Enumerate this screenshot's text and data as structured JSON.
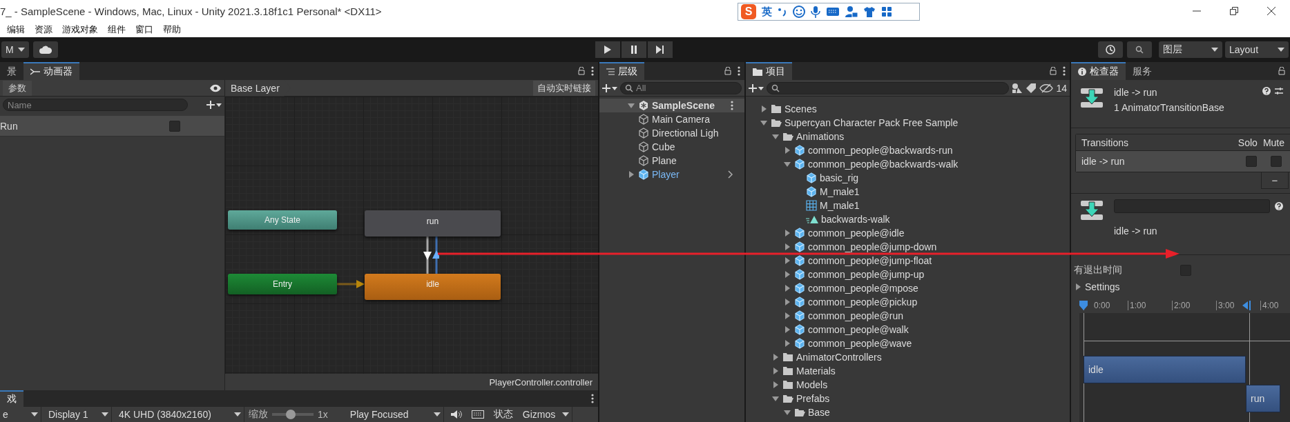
{
  "window": {
    "title": "7_ - SampleScene - Windows, Mac, Linux - Unity 2021.3.18f1c1 Personal* <DX11>"
  },
  "ime_bar": {
    "logo": "S",
    "mode": "英"
  },
  "menu": [
    "编辑",
    "资源",
    "游戏对象",
    "组件",
    "窗口",
    "帮助"
  ],
  "toolbar": {
    "account": "M",
    "layers": "图层",
    "layout": "Layout"
  },
  "animator": {
    "tabs": [
      {
        "label": "景",
        "selected": false
      },
      {
        "label": "动画器",
        "selected": true
      }
    ],
    "params_tab": "参数",
    "search_placeholder": "Name",
    "parameters": [
      {
        "name": "Run",
        "checked": false
      }
    ],
    "layer": "Base Layer",
    "live_link": "自动实时链接",
    "nodes": [
      {
        "label": "Any State",
        "kind": "any"
      },
      {
        "label": "run",
        "kind": "state"
      },
      {
        "label": "Entry",
        "kind": "entry"
      },
      {
        "label": "idle",
        "kind": "default"
      }
    ],
    "footer": "PlayerController.controller"
  },
  "game": {
    "tab": "戏",
    "display_mode": "e",
    "display": "Display 1",
    "resolution": "4K UHD (3840x2160)",
    "scale_label": "缩放",
    "scale_slider": {
      "level": 0.45
    },
    "scale": "1x",
    "play_mode": "Play Focused",
    "stats": "状态",
    "gizmos": "Gizmos"
  },
  "hierarchy": {
    "tab": "层级",
    "search_placeholder": "All",
    "scene": "SampleScene",
    "items": [
      {
        "label": "Main Camera",
        "kind": "object"
      },
      {
        "label": "Directional Ligh",
        "kind": "object"
      },
      {
        "label": "Cube",
        "kind": "object"
      },
      {
        "label": "Plane",
        "kind": "object"
      },
      {
        "label": "Player",
        "kind": "prefab"
      }
    ]
  },
  "project": {
    "tab": "项目",
    "hidden_count": "14",
    "tree": [
      {
        "label": "Scenes",
        "kind": "folder",
        "expanded": false
      },
      {
        "label": "Supercyan Character Pack Free Sample",
        "kind": "folder",
        "expanded": true,
        "children": [
          {
            "label": "Animations",
            "kind": "folder",
            "expanded": true,
            "children": [
              {
                "label": "common_people@backwards-run",
                "kind": "model",
                "expanded": false
              },
              {
                "label": "common_people@backwards-walk",
                "kind": "model",
                "expanded": true,
                "children": [
                  {
                    "label": "basic_rig",
                    "kind": "model"
                  },
                  {
                    "label": "M_male1",
                    "kind": "model"
                  },
                  {
                    "label": "M_male1",
                    "kind": "mesh"
                  },
                  {
                    "label": "backwards-walk",
                    "kind": "clip"
                  }
                ]
              },
              {
                "label": "common_people@idle",
                "kind": "model",
                "expanded": false
              },
              {
                "label": "common_people@jump-down",
                "kind": "model",
                "expanded": false
              },
              {
                "label": "common_people@jump-float",
                "kind": "model",
                "expanded": false
              },
              {
                "label": "common_people@jump-up",
                "kind": "model",
                "expanded": false
              },
              {
                "label": "common_people@mpose",
                "kind": "model",
                "expanded": false
              },
              {
                "label": "common_people@pickup",
                "kind": "model",
                "expanded": false
              },
              {
                "label": "common_people@run",
                "kind": "model",
                "expanded": false
              },
              {
                "label": "common_people@walk",
                "kind": "model",
                "expanded": false
              },
              {
                "label": "common_people@wave",
                "kind": "model",
                "expanded": false
              }
            ]
          },
          {
            "label": "AnimatorControllers",
            "kind": "folder",
            "expanded": false
          },
          {
            "label": "Materials",
            "kind": "folder",
            "expanded": false
          },
          {
            "label": "Models",
            "kind": "folder",
            "expanded": false
          },
          {
            "label": "Prefabs",
            "kind": "folder",
            "expanded": true,
            "children": [
              {
                "label": "Base",
                "kind": "folder",
                "expanded": true
              }
            ]
          }
        ]
      }
    ]
  },
  "inspector": {
    "tabs": [
      {
        "label": "检查器",
        "selected": true
      },
      {
        "label": "服务",
        "selected": false
      }
    ],
    "title": "idle -> run",
    "subtitle": "1 AnimatorTransitionBase",
    "transitions_header": {
      "name": "Transitions",
      "solo": "Solo",
      "mute": "Mute"
    },
    "transitions": [
      {
        "name": "idle -> run",
        "solo": false,
        "mute": false
      }
    ],
    "remove": "−",
    "transition_label": "idle -> run",
    "has_exit_time": {
      "label": "有退出时间",
      "checked": false
    },
    "settings": {
      "label": "Settings",
      "expanded": false
    },
    "timeline": {
      "ticks": [
        "0:00",
        "1:00",
        "2:00",
        "3:00",
        "4:00"
      ],
      "clips": [
        {
          "label": "idle"
        },
        {
          "label": "run"
        }
      ]
    }
  }
}
